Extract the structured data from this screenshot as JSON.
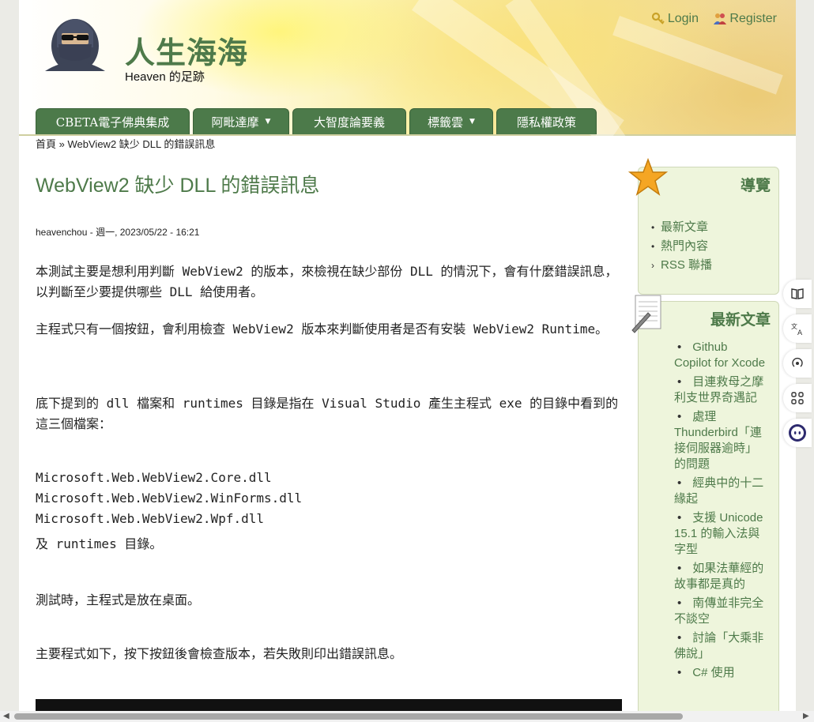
{
  "site": {
    "name": "人生海海",
    "slogan": "Heaven 的足跡"
  },
  "user_links": {
    "login": "Login",
    "register": "Register"
  },
  "nav": [
    {
      "label": "CBETA電子佛典集成",
      "has_dropdown": false
    },
    {
      "label": "阿毗達摩",
      "has_dropdown": true
    },
    {
      "label": "大智度論要義",
      "has_dropdown": false
    },
    {
      "label": "標籤雲",
      "has_dropdown": true
    },
    {
      "label": "隱私權政策",
      "has_dropdown": false
    }
  ],
  "breadcrumb": {
    "home": "首頁",
    "separator": "»",
    "current": "WebView2 缺少 DLL 的錯誤訊息"
  },
  "article": {
    "title": "WebView2 缺少 DLL 的錯誤訊息",
    "author": "heavenchou",
    "submitted": "- 週一, 2023/05/22 - 16:21",
    "paragraphs": [
      "本測試主要是想利用判斷 WebView2 的版本，來檢視在缺少部份 DLL 的情況下，會有什麼錯誤訊息，以判斷至少要提供哪些 DLL 給使用者。",
      "主程式只有一個按鈕，會利用檢查 WebView2 版本來判斷使用者是否有安裝 WebView2 Runtime。",
      "底下提到的 dll 檔案和 runtimes 目錄是指在 Visual Studio 產生主程式 exe 的目錄中看到的這三個檔案：",
      "Microsoft.Web.WebView2.Core.dll",
      "Microsoft.Web.WebView2.WinForms.dll",
      "Microsoft.Web.WebView2.Wpf.dll",
      "及 runtimes 目錄。",
      "測試時，主程式是放在桌面。",
      "主要程式如下，按下按鈕後會檢查版本，若失敗則印出錯誤訊息。"
    ]
  },
  "sidebar": {
    "navigation": {
      "title": "導覽",
      "items": [
        {
          "label": "最新文章",
          "marker": "•"
        },
        {
          "label": "熱門內容",
          "marker": "•"
        },
        {
          "label": "RSS 聯播",
          "marker": "›"
        }
      ]
    },
    "recent": {
      "title": "最新文章",
      "items": [
        "Github Copilot for Xcode",
        "目連救母之摩利支世界奇遇記",
        "處理 Thunderbird「連接伺服器逾時」的問題",
        "經典中的十二緣起",
        "支援 Unicode 15.1 的輸入法與字型",
        "如果法華經的故事都是真的",
        "南傳並非完全不談空",
        "討論「大乘非佛說」",
        "C# 使用"
      ]
    }
  },
  "colors": {
    "accent_green": "#4e7a4a",
    "nav_bg": "#4c7a4a",
    "sidebar_bg": "#eef5dc"
  }
}
